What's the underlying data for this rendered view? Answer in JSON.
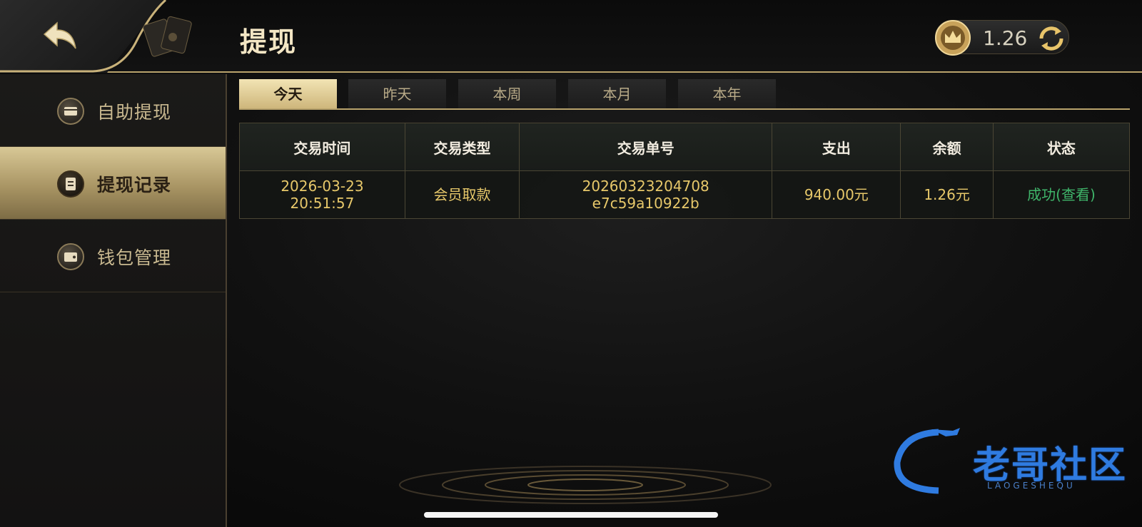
{
  "header": {
    "title": "提现",
    "balance": "1.26"
  },
  "sidebar": {
    "items": [
      {
        "label": "自助提现",
        "icon": "card-icon"
      },
      {
        "label": "提现记录",
        "icon": "record-icon"
      },
      {
        "label": "钱包管理",
        "icon": "wallet-icon"
      }
    ],
    "active_index": 1
  },
  "tabs": {
    "items": [
      "今天",
      "昨天",
      "本周",
      "本月",
      "本年"
    ],
    "active_index": 0
  },
  "table": {
    "columns": [
      "交易时间",
      "交易类型",
      "交易单号",
      "支出",
      "余额",
      "状态"
    ],
    "rows": [
      {
        "time_date": "2026-03-23",
        "time_clock": "20:51:57",
        "type": "会员取款",
        "order_part1": "20260323204708",
        "order_part2": "e7c59a10922b",
        "expense": "940.00元",
        "balance": "1.26元",
        "status": "成功(查看)"
      }
    ]
  },
  "watermark": {
    "text": "老哥社区",
    "sub": "LAOGESHEQU"
  },
  "colors": {
    "gold": "#b9a36c",
    "value_gold": "#e7c86a",
    "success_green": "#3fb56a",
    "watermark_blue": "#2f7be0"
  }
}
